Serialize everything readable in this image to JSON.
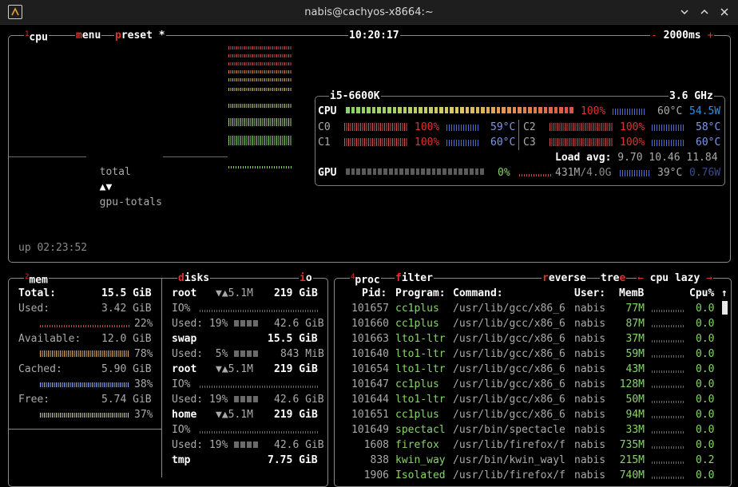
{
  "window": {
    "title": "nabis@cachyos-x8664:~"
  },
  "cpu_box": {
    "num": "1",
    "tab_cpu": "cpu",
    "tab_menu": "menu",
    "tab_preset": "preset *",
    "clock": "10:20:17",
    "minus": "-",
    "interval": "2000ms",
    "plus": "+",
    "total_label": "total",
    "arrows": "▲▼",
    "gpu_totals": "gpu-totals",
    "uptime": "up 02:23:52"
  },
  "cpu_info": {
    "model": "i5-6600K",
    "freq": "3.6 GHz",
    "cpu_label": "CPU",
    "cpu_pct": "100%",
    "cpu_temp": "60°C",
    "cpu_power": "54.5W",
    "cores": [
      {
        "label": "C0",
        "pct": "100%",
        "temp": "59°C"
      },
      {
        "label": "C1",
        "pct": "100%",
        "temp": "60°C"
      },
      {
        "label": "C2",
        "pct": "100%",
        "temp": "58°C"
      },
      {
        "label": "C3",
        "pct": "100%",
        "temp": "60°C"
      }
    ],
    "load_label": "Load avg:",
    "load1": "9.70",
    "load5": "10.46",
    "load15": "11.84",
    "gpu_label": "GPU",
    "gpu_pct": "0%",
    "gpu_mem_used": "431M",
    "gpu_mem_total": "/4.0G",
    "gpu_temp": "39°C",
    "gpu_power": "0.76W",
    "cpu_usage_percent": 100,
    "gpu_usage_percent": 0
  },
  "mem": {
    "num": "2",
    "tab": "mem",
    "total_label": "Total:",
    "total": "15.5 GiB",
    "rows": [
      {
        "label": "Used:",
        "value": "3.42 GiB",
        "pct": "22%"
      },
      {
        "label": "Available:",
        "value": "12.0 GiB",
        "pct": "78%"
      },
      {
        "label": "Cached:",
        "value": "5.90 GiB",
        "pct": "38%"
      },
      {
        "label": "Free:",
        "value": "5.74 GiB",
        "pct": "37%"
      }
    ]
  },
  "disks": {
    "tab": "disks",
    "io_tab": "io",
    "entries": [
      {
        "name": "root",
        "rw": "▼▲5.1M",
        "size": "219 GiB",
        "io": "IO%",
        "used_label": "Used:",
        "used_pct": "19%",
        "used": "42.6 GiB"
      },
      {
        "name": "swap",
        "size": "15.5 GiB",
        "used_label": "Used:",
        "used_pct": "5%",
        "used": "843 MiB"
      },
      {
        "name": "root",
        "rw": "▼▲5.1M",
        "size": "219 GiB",
        "io": "IO%",
        "used_label": "Used:",
        "used_pct": "19%",
        "used": "42.6 GiB"
      },
      {
        "name": "home",
        "rw": "▼▲5.1M",
        "size": "219 GiB",
        "io": "IO%",
        "used_label": "Used:",
        "used_pct": "19%",
        "used": "42.6 GiB"
      },
      {
        "name": "tmp",
        "size": "7.75 GiB"
      }
    ]
  },
  "proc": {
    "num": "4",
    "tab": "proc",
    "filter": "filter",
    "reverse": "reverse",
    "tree": "tree",
    "arrow": "←",
    "sort": "cpu lazy",
    "arrow_r": "→",
    "headers": {
      "pid": "Pid:",
      "program": "Program:",
      "command": "Command:",
      "user": "User:",
      "mem": "MemB",
      "cpu": "Cpu%"
    },
    "scroll_up": "↑",
    "rows": [
      {
        "pid": "101657",
        "program": "cc1plus",
        "command": "/usr/lib/gcc/x86_6",
        "user": "nabis",
        "mem": "77M",
        "cpu": "0.0"
      },
      {
        "pid": "101660",
        "program": "cc1plus",
        "command": "/usr/lib/gcc/x86_6",
        "user": "nabis",
        "mem": "87M",
        "cpu": "0.0"
      },
      {
        "pid": "101663",
        "program": "lto1-ltr",
        "command": "/usr/lib/gcc/x86_6",
        "user": "nabis",
        "mem": "37M",
        "cpu": "0.0"
      },
      {
        "pid": "101640",
        "program": "lto1-ltr",
        "command": "/usr/lib/gcc/x86_6",
        "user": "nabis",
        "mem": "59M",
        "cpu": "0.0"
      },
      {
        "pid": "101654",
        "program": "lto1-ltr",
        "command": "/usr/lib/gcc/x86_6",
        "user": "nabis",
        "mem": "43M",
        "cpu": "0.0"
      },
      {
        "pid": "101647",
        "program": "cc1plus",
        "command": "/usr/lib/gcc/x86_6",
        "user": "nabis",
        "mem": "128M",
        "cpu": "0.0"
      },
      {
        "pid": "101644",
        "program": "lto1-ltr",
        "command": "/usr/lib/gcc/x86_6",
        "user": "nabis",
        "mem": "50M",
        "cpu": "0.0"
      },
      {
        "pid": "101651",
        "program": "cc1plus",
        "command": "/usr/lib/gcc/x86_6",
        "user": "nabis",
        "mem": "94M",
        "cpu": "0.0"
      },
      {
        "pid": "101649",
        "program": "spectacl",
        "command": "/usr/bin/spectacle",
        "user": "nabis",
        "mem": "33M",
        "cpu": "0.0"
      },
      {
        "pid": "1608",
        "program": "firefox",
        "command": "/usr/lib/firefox/f",
        "user": "nabis",
        "mem": "735M",
        "cpu": "0.0"
      },
      {
        "pid": "838",
        "program": "kwin_way",
        "command": "/usr/bin/kwin_wayl",
        "user": "nabis",
        "mem": "215M",
        "cpu": "0.2"
      },
      {
        "pid": "1906",
        "program": "Isolated",
        "command": "/usr/lib/firefox/f",
        "user": "nabis",
        "mem": "740M",
        "cpu": "0.0"
      }
    ]
  }
}
